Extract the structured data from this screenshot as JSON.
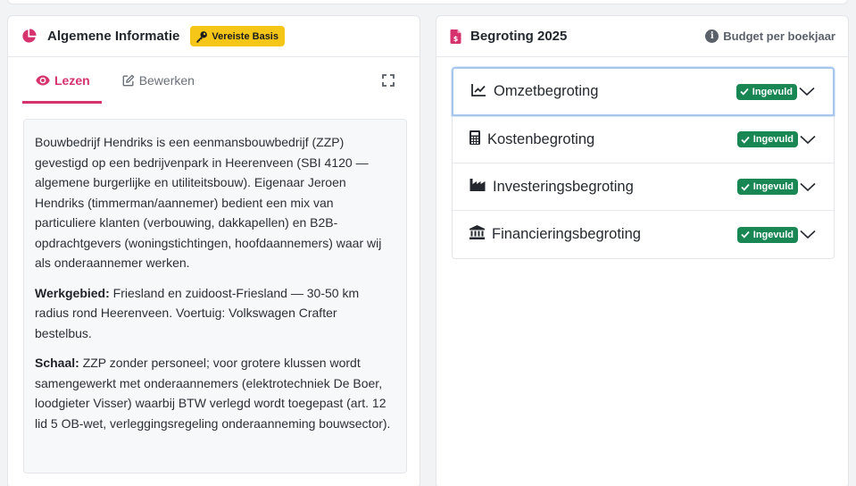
{
  "left_card": {
    "title": "Algemene Informatie",
    "badge": "Vereiste Basis",
    "tabs": [
      {
        "label": "Lezen"
      },
      {
        "label": "Bewerken"
      }
    ],
    "content": {
      "intro": "Bouwbedrijf Hendriks is een eenmansbouwbedrijf (ZZP) gevestigd op een bedrijvenpark in Heerenveen (SBI 4120 — algemene burgerlijke en utiliteitsbouw). Eigenaar Jeroen Hendriks (timmerman/aannemer) bedient een mix van particuliere klanten (verbouwing, dakkapellen) en B2B-opdrachtgevers (woningstichtingen, hoofdaannemers) waar wij als onderaannemer werken.",
      "werkgebied_label": "Werkgebied:",
      "werkgebied_text": " Friesland en zuidoost-Friesland — 30-50 km radius rond Heerenveen. Voertuig: Volkswagen Crafter bestelbus.",
      "schaal_label": "Schaal:",
      "schaal_text": " ZZP zonder personeel; voor grotere klussen wordt samengewerkt met onderaannemers (elektrotechniek De Boer, loodgieter Visser) waarbij BTW verlegd wordt toegepast (art. 12 lid 5 OB-wet, verleggingsregeling onderaanneming bouwsector)."
    }
  },
  "right_card": {
    "title": "Begroting 2025",
    "note": "Budget per boekjaar",
    "items": [
      {
        "label": "Omzetbegroting",
        "status": "Ingevuld",
        "icon": "chart-line-icon"
      },
      {
        "label": "Kostenbegroting",
        "status": "Ingevuld",
        "icon": "calculator-icon"
      },
      {
        "label": "Investeringsbegroting",
        "status": "Ingevuld",
        "icon": "industry-icon"
      },
      {
        "label": "Financieringsbegroting",
        "status": "Ingevuld",
        "icon": "bank-icon"
      }
    ]
  },
  "colors": {
    "accent": "#d6336c",
    "badge_yellow": "#f5c518",
    "status_green": "#198754",
    "focus_border": "#a6c6ee"
  }
}
